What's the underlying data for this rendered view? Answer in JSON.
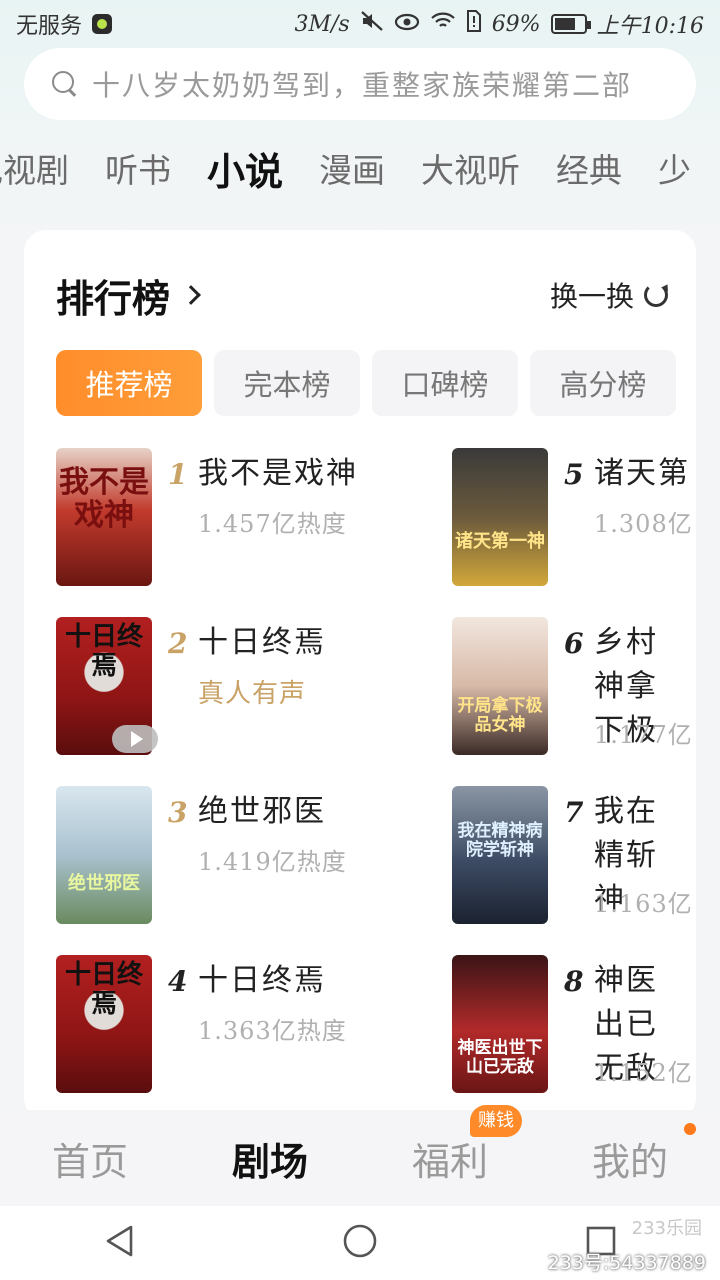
{
  "status_bar": {
    "carrier": "无服务",
    "speed": "3M/s",
    "battery": "69%",
    "time": "上午10:16"
  },
  "search": {
    "placeholder": "十八岁太奶奶驾到，重整家族荣耀第二部"
  },
  "category_tabs": [
    "电视剧",
    "听书",
    "小说",
    "漫画",
    "大视听",
    "经典",
    "少"
  ],
  "active_category": "小说",
  "card": {
    "title": "排行榜",
    "refresh_label": "换一换",
    "rank_tabs": [
      "推荐榜",
      "完本榜",
      "口碑榜",
      "高分榜"
    ],
    "active_rank_tab": "推荐榜"
  },
  "books": [
    {
      "rank": "1",
      "title": "我不是戏神",
      "meta": "1.457亿热度",
      "cover_text": "我不是戏神"
    },
    {
      "rank": "2",
      "title": "十日终焉",
      "meta": "真人有声",
      "cover_text": "十日终焉"
    },
    {
      "rank": "3",
      "title": "绝世邪医",
      "meta": "1.419亿热度",
      "cover_text": "绝世邪医"
    },
    {
      "rank": "4",
      "title": "十日终焉",
      "meta": "1.363亿热度",
      "cover_text": "十日终焉"
    },
    {
      "rank": "5",
      "title": "诸天第",
      "meta": "1.308亿",
      "cover_text": "诸天第一神"
    },
    {
      "rank": "6",
      "title": "乡村神拿下极",
      "meta": "1.177亿",
      "cover_text": "开局拿下极品女神"
    },
    {
      "rank": "7",
      "title": "我在精斩神",
      "meta": "1.163亿",
      "cover_text": "我在精神病院学斩神"
    },
    {
      "rank": "8",
      "title": "神医出已无敌",
      "meta": "1.152亿",
      "cover_text": "神医出世下山已无敌"
    }
  ],
  "bottom_nav": {
    "items": [
      "首页",
      "剧场",
      "福利",
      "我的"
    ],
    "active": "剧场",
    "badge": "赚钱"
  },
  "watermark": {
    "logo": "233乐园",
    "id": "233号:54337889"
  },
  "colors": {
    "accent": "#ff8d2a",
    "rank_gold": "#c9a266",
    "background": "#f4f5f7"
  }
}
